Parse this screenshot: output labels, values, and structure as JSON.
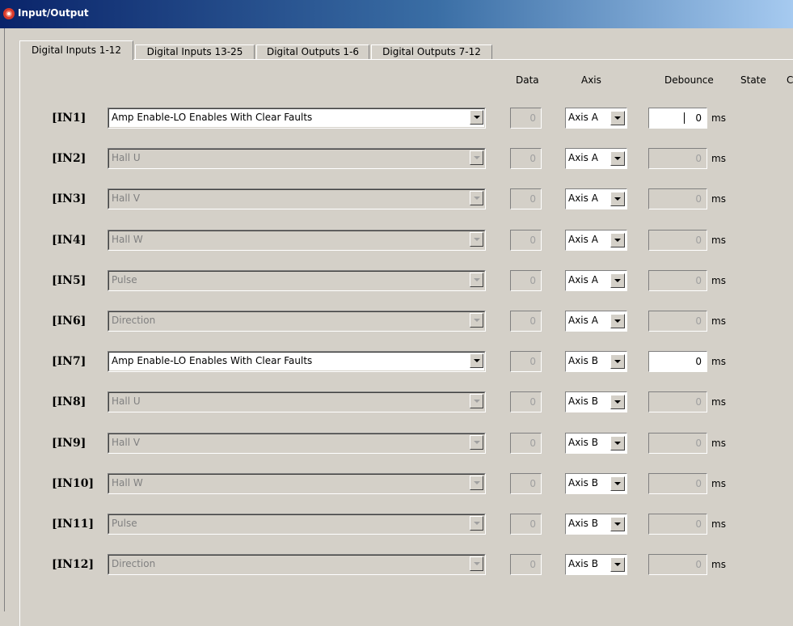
{
  "window": {
    "title": "Input/Output"
  },
  "tabs": [
    {
      "label": "Digital Inputs 1-12",
      "active": true
    },
    {
      "label": "Digital Inputs 13-25",
      "active": false
    },
    {
      "label": "Digital Outputs 1-6",
      "active": false
    },
    {
      "label": "Digital Outputs 7-12",
      "active": false
    }
  ],
  "headers": {
    "data": "Data",
    "axis": "Axis",
    "debounce": "Debounce",
    "state": "State",
    "cutoff": "C"
  },
  "unit": "ms",
  "rows": [
    {
      "label": "[IN1]",
      "function": "Amp Enable-LO Enables With Clear Faults",
      "enabled": true,
      "data": "0",
      "axis": "Axis A",
      "debounce": "0"
    },
    {
      "label": "[IN2]",
      "function": "Hall U",
      "enabled": false,
      "data": "0",
      "axis": "Axis A",
      "debounce": "0"
    },
    {
      "label": "[IN3]",
      "function": "Hall V",
      "enabled": false,
      "data": "0",
      "axis": "Axis A",
      "debounce": "0"
    },
    {
      "label": "[IN4]",
      "function": "Hall W",
      "enabled": false,
      "data": "0",
      "axis": "Axis A",
      "debounce": "0"
    },
    {
      "label": "[IN5]",
      "function": "Pulse",
      "enabled": false,
      "data": "0",
      "axis": "Axis A",
      "debounce": "0"
    },
    {
      "label": "[IN6]",
      "function": "Direction",
      "enabled": false,
      "data": "0",
      "axis": "Axis A",
      "debounce": "0"
    },
    {
      "label": "[IN7]",
      "function": "Amp Enable-LO Enables With Clear Faults",
      "enabled": true,
      "data": "0",
      "axis": "Axis B",
      "debounce": "0"
    },
    {
      "label": "[IN8]",
      "function": "Hall U",
      "enabled": false,
      "data": "0",
      "axis": "Axis B",
      "debounce": "0"
    },
    {
      "label": "[IN9]",
      "function": "Hall V",
      "enabled": false,
      "data": "0",
      "axis": "Axis B",
      "debounce": "0"
    },
    {
      "label": "[IN10]",
      "function": "Hall W",
      "enabled": false,
      "data": "0",
      "axis": "Axis B",
      "debounce": "0"
    },
    {
      "label": "[IN11]",
      "function": "Pulse",
      "enabled": false,
      "data": "0",
      "axis": "Axis B",
      "debounce": "0"
    },
    {
      "label": "[IN12]",
      "function": "Direction",
      "enabled": false,
      "data": "0",
      "axis": "Axis B",
      "debounce": "0"
    }
  ],
  "colors": {
    "titlebar_start": "#0a246a",
    "titlebar_end": "#a6caf0",
    "face": "#d4d0c8",
    "disabled_text": "#808080"
  },
  "icons": {
    "app": "app-logo-icon",
    "dropdown": "chevron-down-icon"
  }
}
